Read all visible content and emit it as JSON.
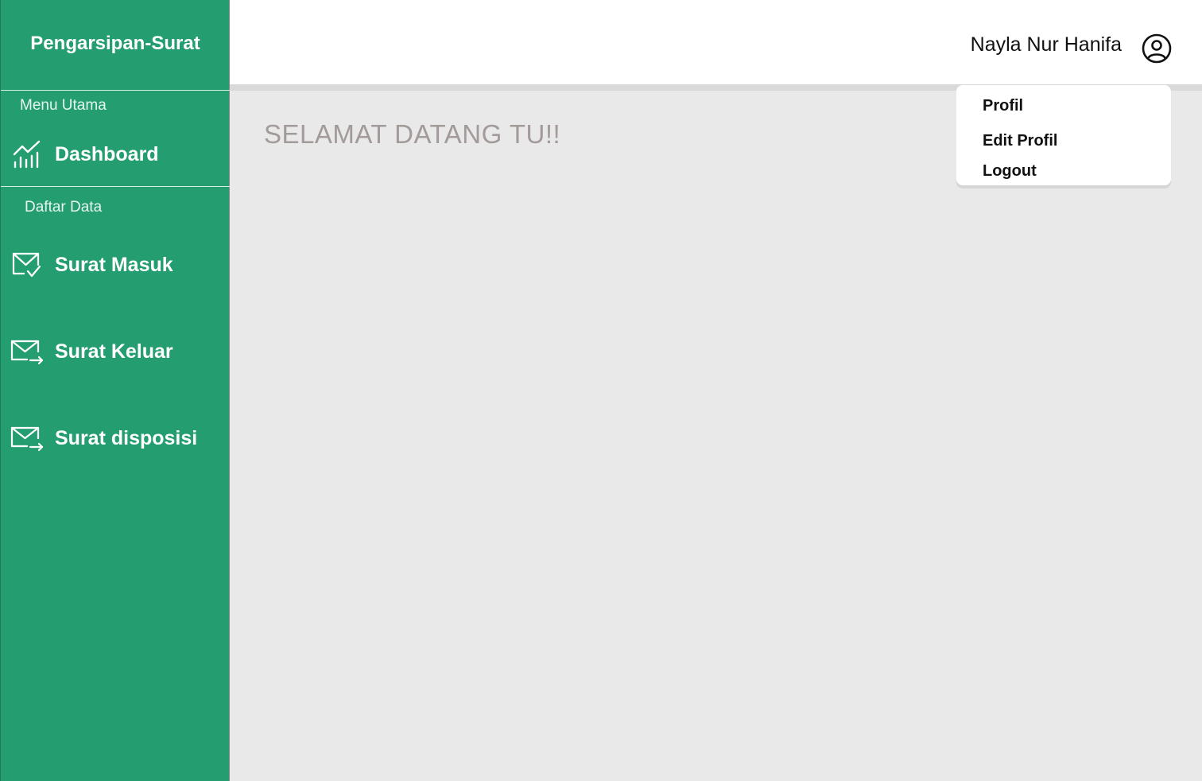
{
  "sidebar": {
    "brand": "Pengarsipan-Surat",
    "section_main": "Menu Utama",
    "section_data": "Daftar Data",
    "items": [
      {
        "label": "Dashboard",
        "icon": "chart-icon"
      },
      {
        "label": "Surat Masuk",
        "icon": "mail-check-icon"
      },
      {
        "label": "Surat Keluar",
        "icon": "mail-send-icon"
      },
      {
        "label": "Surat disposisi",
        "icon": "mail-send-icon"
      }
    ]
  },
  "header": {
    "user_name": "Nayla Nur Hanifa",
    "user_icon": "user-circle-icon"
  },
  "main": {
    "welcome": "SELAMAT DATANG TU!!"
  },
  "dropdown": {
    "items": [
      {
        "label": "Profil"
      },
      {
        "label": "Edit Profil"
      },
      {
        "label": "Logout"
      }
    ]
  },
  "colors": {
    "sidebar_bg": "#249e71",
    "content_bg": "#e9e9e9",
    "header_bg": "#ffffff",
    "welcome_text": "#a39a9a"
  }
}
